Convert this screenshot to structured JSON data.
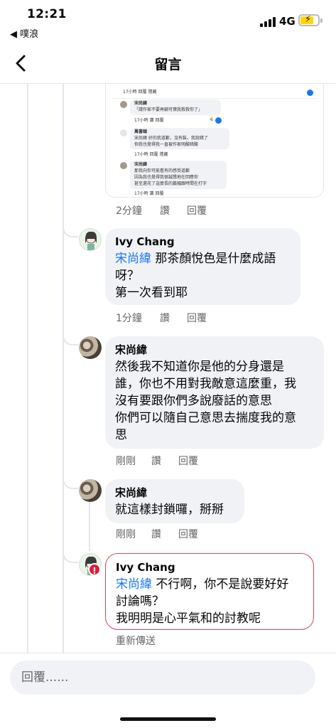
{
  "status_bar": {
    "time": "12:21",
    "back_app": "◀ 噗浪",
    "network": "4G"
  },
  "header": {
    "title": "留言"
  },
  "screenshot_comment": {
    "lines": [
      "17小時  回覆  隱藏",
      "宋尚緯",
      "「請作家不要再躺可憐我救救你了」",
      "17小時  讚  回覆",
      "萬書頤",
      "宋尚緯 好的我道歉，沒有裝，我說錯了",
      "但我也覺得我一直被作家明酸暗酸",
      "17小時  回覆  隱藏",
      "宋尚緯",
      "那我向你可能看有的感受道歉",
      "因為我也覺得我很誠懇地在回應你",
      "甚至還花了這麼長的篇幅跟時間在打字",
      "17小時  讚  回覆"
    ],
    "like_count": "6",
    "time": "2分鐘",
    "like_label": "讚",
    "reply_label": "回覆"
  },
  "comments": [
    {
      "author": "Ivy Chang",
      "mention": "宋尚緯",
      "text": " 那茶顏悅色是什麼成語\n呀？\n第一次看到耶",
      "time": "1分鐘",
      "like_label": "讚",
      "reply_label": "回覆"
    },
    {
      "author": "宋尚緯",
      "text": "然後我不知道你是他的分身還是\n誰，你也不用對我敵意這麼重，我\n沒有要跟你們多說廢話的意思\n你們可以隨自己意思去揣度我的意\n思",
      "time": "剛剛",
      "like_label": "讚",
      "reply_label": "回覆"
    },
    {
      "author": "宋尚緯",
      "text": "就這樣封鎖囉，掰掰",
      "time": "剛剛",
      "like_label": "讚",
      "reply_label": "回覆"
    },
    {
      "author": "Ivy Chang",
      "mention": "宋尚緯",
      "text": " 不行啊，你不是說要好好\n討論嗎？\n我明明是心平氣和的討教呢",
      "status": "重新傳送",
      "error_mark": "!"
    }
  ],
  "reply_bar": {
    "placeholder": "回覆......"
  },
  "colors": {
    "mention": "#1877f2",
    "error_border": "#d9435b",
    "bubble_bg": "#f0f2f5",
    "meta_text": "#65676b"
  }
}
